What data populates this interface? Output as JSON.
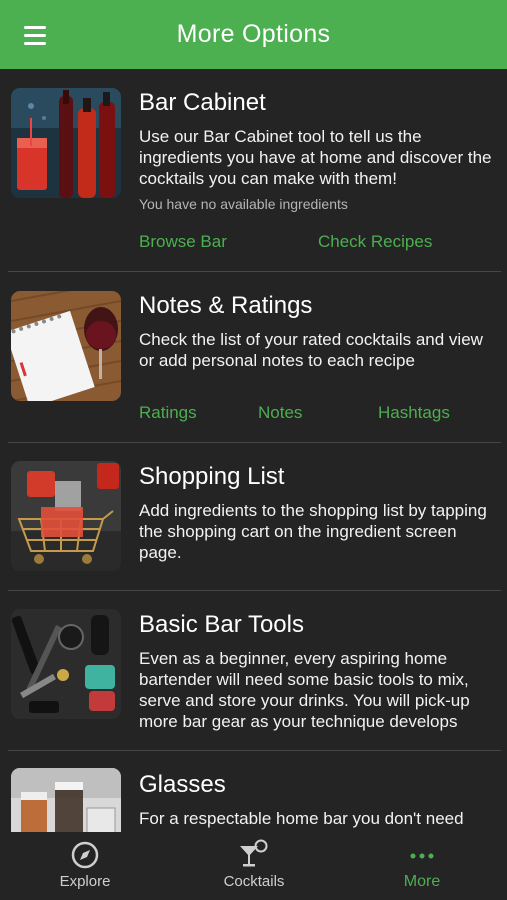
{
  "header": {
    "title": "More Options",
    "menu_icon": "hamburger-menu-icon"
  },
  "colors": {
    "accent": "#4caf50",
    "background": "#242424"
  },
  "cards": [
    {
      "title": "Bar Cabinet",
      "description": "Use our Bar Cabinet tool to tell us the ingredients you have at home and discover the cocktails you can make with them!",
      "note": "You have no available ingredients",
      "links": [
        "Browse Bar",
        "Check Recipes"
      ]
    },
    {
      "title": "Notes & Ratings",
      "description": "Check the list of your rated cocktails and view or add personal notes to each recipe",
      "links": [
        "Ratings",
        "Notes",
        "Hashtags"
      ]
    },
    {
      "title": "Shopping List",
      "description": "Add ingredients to the shopping list by tapping the shopping cart on the ingredient screen page."
    },
    {
      "title": "Basic Bar Tools",
      "description": "Even as a beginner, every aspiring home bartender will need some basic tools to mix, serve and store your drinks. You will pick-up more bar gear as your technique develops"
    },
    {
      "title": "Glasses",
      "description": "For a respectable home bar you don't need"
    }
  ],
  "bottom_nav": [
    {
      "label": "Explore",
      "icon": "compass-icon"
    },
    {
      "label": "Cocktails",
      "icon": "cocktail-glass-icon"
    },
    {
      "label": "More",
      "icon": "more-dots-icon",
      "active": true
    }
  ]
}
